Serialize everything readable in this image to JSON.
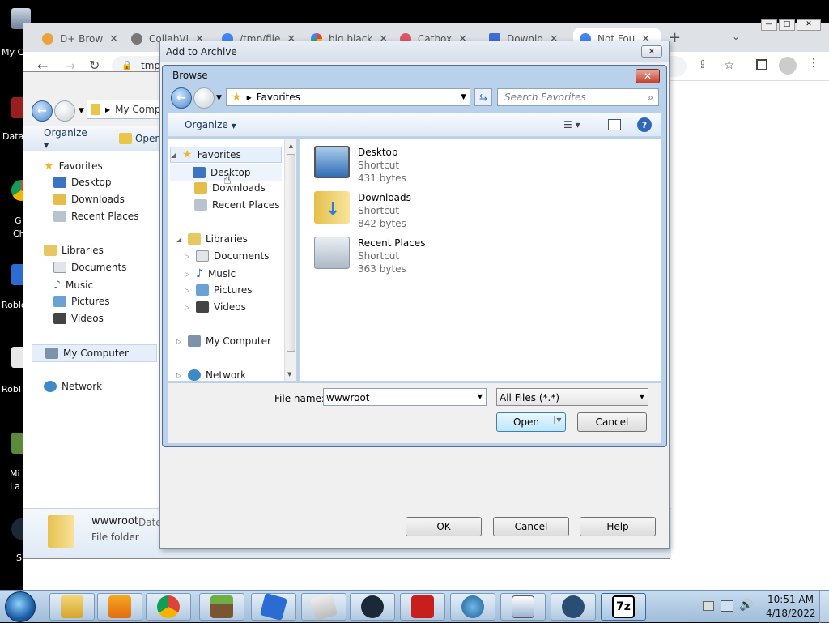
{
  "desktop": {
    "icons": [
      "My C",
      "Data",
      "G\nCh",
      "Roblo",
      "Robl",
      "Mi\nLa",
      "S"
    ]
  },
  "chrome": {
    "tabs": [
      "D+ Brow",
      "CollabVI",
      "/tmp/file",
      "big black",
      "Catbox",
      "Downlo",
      "Not Fou"
    ],
    "url": "tmp"
  },
  "explorer": {
    "location": "My Comp",
    "toolbar": {
      "organize": "Organize",
      "open": "Open"
    },
    "nav": {
      "favorites": "Favorites",
      "desktop": "Desktop",
      "downloads": "Downloads",
      "recent_places": "Recent Places",
      "libraries": "Libraries",
      "documents": "Documents",
      "music": "Music",
      "pictures": "Pictures",
      "videos": "Videos",
      "my_computer": "My Computer",
      "network": "Network"
    },
    "details": {
      "name": "wwwroot",
      "date_label": "Date",
      "type": "File folder"
    }
  },
  "archive": {
    "title": "Add to Archive",
    "buttons": {
      "ok": "OK",
      "cancel": "Cancel",
      "help": "Help"
    }
  },
  "browse": {
    "title": "Browse",
    "address": "Favorites",
    "search_placeholder": "Search Favorites",
    "organize": "Organize",
    "nav": {
      "favorites": "Favorites",
      "desktop": "Desktop",
      "downloads": "Downloads",
      "recent_places": "Recent Places",
      "libraries": "Libraries",
      "documents": "Documents",
      "music": "Music",
      "pictures": "Pictures",
      "videos": "Videos",
      "my_computer": "My Computer",
      "network": "Network"
    },
    "files": [
      {
        "name": "Desktop",
        "type": "Shortcut",
        "size": "431 bytes",
        "icon": "desktop-shortcut-icon"
      },
      {
        "name": "Downloads",
        "type": "Shortcut",
        "size": "842 bytes",
        "icon": "downloads-shortcut-icon"
      },
      {
        "name": "Recent Places",
        "type": "Shortcut",
        "size": "363 bytes",
        "icon": "recent-places-shortcut-icon"
      }
    ],
    "filename_label": "File name:",
    "filename_value": "wwwroot",
    "filter_value": "All Files (*.*)",
    "open_label": "Open",
    "cancel_label": "Cancel"
  },
  "taskbar": {
    "time": "10:51 AM",
    "date": "4/18/2022",
    "pinned": [
      "explorer",
      "media-player",
      "chrome",
      "minecraft",
      "roblox",
      "tablet",
      "steam",
      "d-app",
      "globe-d",
      "whiteboard",
      "steam-2",
      "7zip"
    ],
    "seven_zip_label": "7z"
  },
  "colors": {
    "accent": "#3c7fb1",
    "title_blue": "#b9d1ea"
  }
}
